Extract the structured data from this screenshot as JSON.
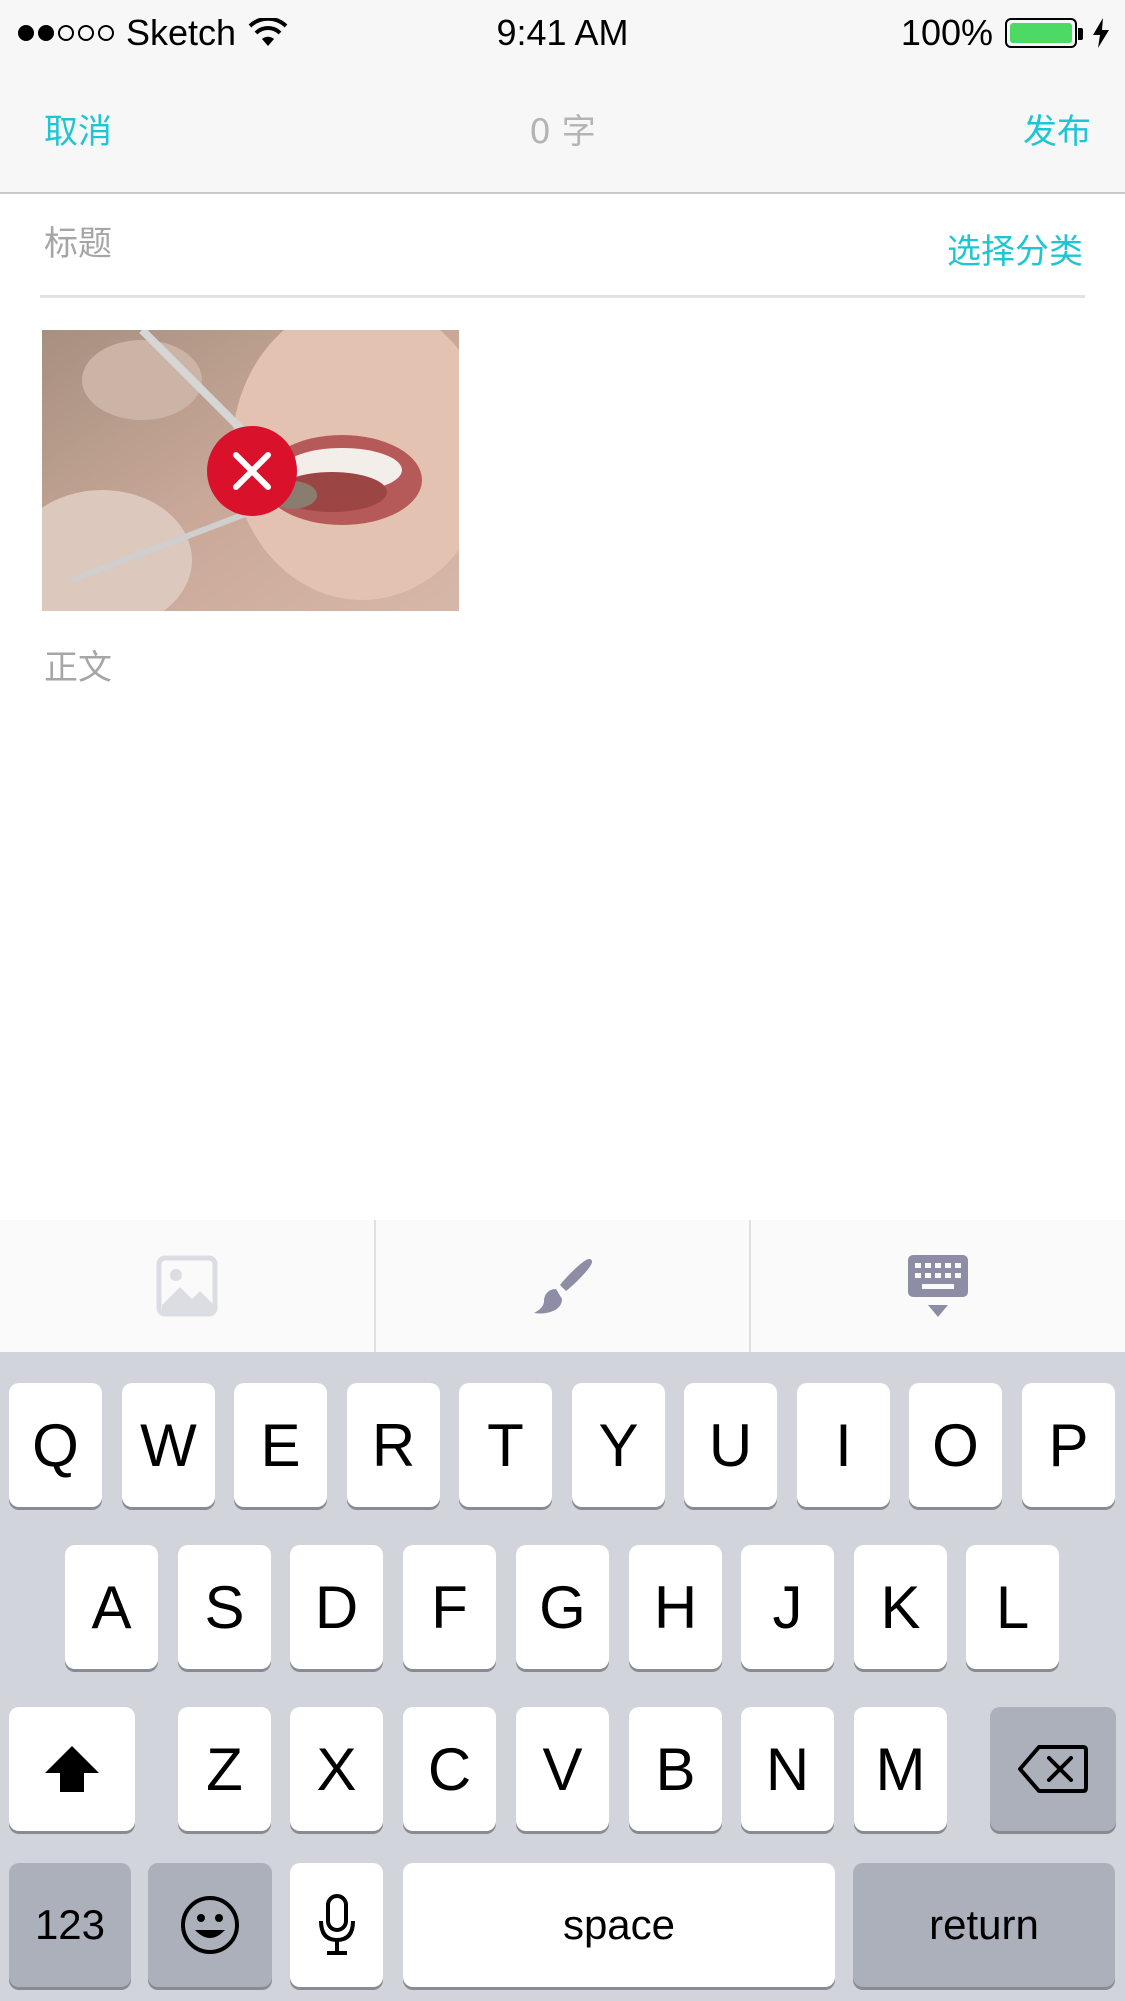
{
  "status_bar": {
    "carrier": "Sketch",
    "time": "9:41 AM",
    "battery": "100%",
    "battery_color": "#4cd964"
  },
  "nav": {
    "cancel": "取消",
    "char_count": "0 字",
    "publish": "发布",
    "accent_color": "#1ec6d4"
  },
  "editor": {
    "title_placeholder": "标题",
    "category": "选择分类",
    "body_placeholder": "正文",
    "photo": {
      "subject": "dental-exam-photo",
      "delete_icon": "close-icon",
      "delete_color": "#d9112a"
    }
  },
  "toolbar": {
    "items": [
      "image-icon",
      "brush-icon",
      "keyboard-hide-icon"
    ]
  },
  "keyboard": {
    "row1": [
      "Q",
      "W",
      "E",
      "R",
      "T",
      "Y",
      "U",
      "I",
      "O",
      "P"
    ],
    "row2": [
      "A",
      "S",
      "D",
      "F",
      "G",
      "H",
      "J",
      "K",
      "L"
    ],
    "row3": [
      "Z",
      "X",
      "C",
      "V",
      "B",
      "N",
      "M"
    ],
    "numbers": "123",
    "space": "space",
    "return": "return",
    "icons": [
      "shift-icon",
      "backspace-icon",
      "emoji-icon",
      "microphone-icon"
    ]
  }
}
